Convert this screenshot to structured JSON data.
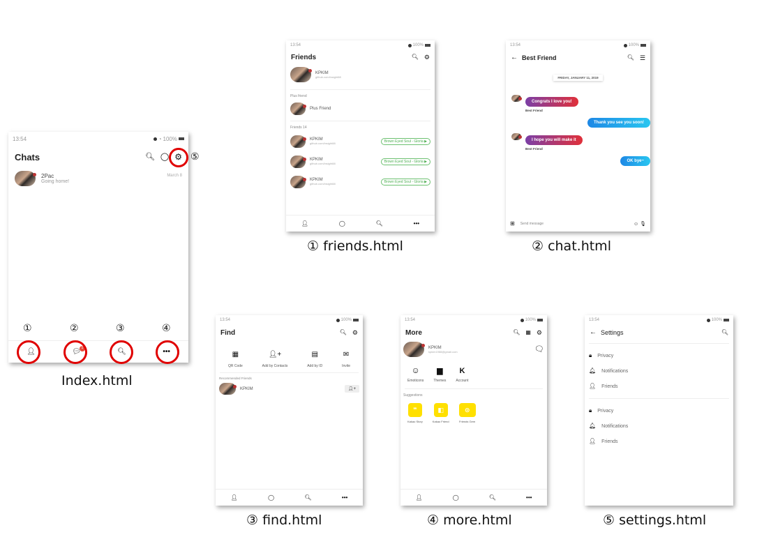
{
  "status": {
    "time": "13:54",
    "battery": "100%"
  },
  "index": {
    "title": "Chats",
    "chat": {
      "name": "2Pac",
      "message": "Going home!",
      "date": "March 8"
    },
    "badge": "1",
    "caption": "Index.html"
  },
  "friends": {
    "title": "Friends",
    "me": {
      "name": "KPKIM",
      "sub": "github.com/insight88"
    },
    "plus_section": "Plus friend",
    "plus_item": "Plus Friend",
    "friends_section": "Friends 14",
    "items": [
      {
        "name": "KPKIM",
        "sub": "github.com/insight88",
        "music": "Brown Eyed Soul - Gloria ▶"
      },
      {
        "name": "KPKIM",
        "sub": "github.com/insight88",
        "music": "Brown Eyed Soul - Gloria ▶"
      },
      {
        "name": "KPKIM",
        "sub": "github.com/insight88",
        "music": "Brown Eyed Soul - Gloria ▶"
      }
    ],
    "caption": "① friends.html"
  },
  "chat": {
    "title": "Best Friend",
    "date": "FRIDAY, JANUARY 11, 2019",
    "messages": [
      {
        "side": "left",
        "text": "Congrats I love you!",
        "sender": "Best Friend"
      },
      {
        "side": "right",
        "text": "Thank you see you soon!"
      },
      {
        "side": "left",
        "text": "I hope you will make it",
        "sender": "Best Friend"
      },
      {
        "side": "right",
        "text": "OK bye~"
      }
    ],
    "input_placeholder": "Send message",
    "caption": "② chat.html"
  },
  "find": {
    "title": "Find",
    "actions": [
      "QR Code",
      "Add by Contacts",
      "Add by ID",
      "Invite"
    ],
    "section": "Recommended Friends",
    "friend": "KPKIM",
    "caption": "③ find.html"
  },
  "more": {
    "title": "More",
    "me": {
      "name": "KPKIM",
      "sub": "kpkim1988@gmail.com"
    },
    "actions": [
      "Emoticons",
      "Themes",
      "Account"
    ],
    "section": "Suggestions",
    "suggestions": [
      "Kakao Story",
      "Kakao Friend",
      "Friends Gem"
    ],
    "caption": "④ more.html"
  },
  "settings": {
    "title": "Settings",
    "group1": [
      "Privacy",
      "Notifications",
      "Friends"
    ],
    "group2": [
      "Privacy",
      "Notifications",
      "Friends"
    ],
    "caption": "⑤ settings.html"
  },
  "markers": [
    "①",
    "②",
    "③",
    "④",
    "⑤"
  ]
}
